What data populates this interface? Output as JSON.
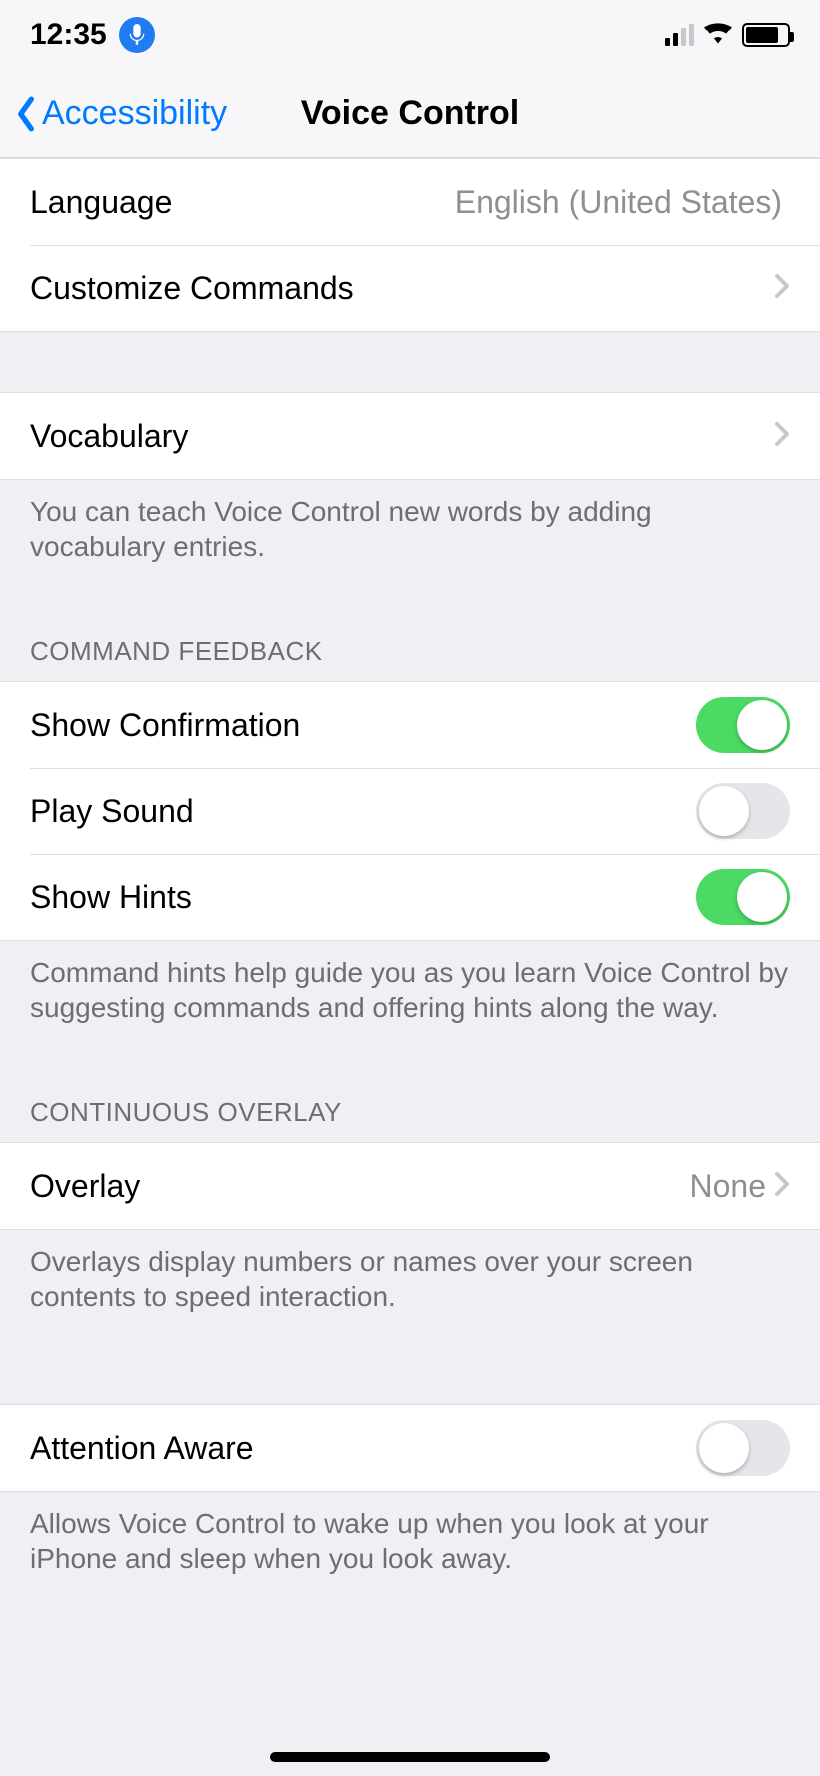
{
  "status": {
    "time": "12:35"
  },
  "nav": {
    "back": "Accessibility",
    "title": "Voice Control"
  },
  "rows": {
    "language": {
      "label": "Language",
      "value": "English (United States)"
    },
    "customize": {
      "label": "Customize Commands"
    },
    "vocabulary": {
      "label": "Vocabulary"
    },
    "vocabulary_footer": "You can teach Voice Control new words by adding vocabulary entries.",
    "feedback_header": "COMMAND FEEDBACK",
    "show_conf": {
      "label": "Show Confirmation",
      "on": true
    },
    "play_sound": {
      "label": "Play Sound",
      "on": false
    },
    "show_hints": {
      "label": "Show Hints",
      "on": true
    },
    "feedback_footer": "Command hints help guide you as you learn Voice Control by suggesting commands and offering hints along the way.",
    "overlay_header": "CONTINUOUS OVERLAY",
    "overlay": {
      "label": "Overlay",
      "value": "None"
    },
    "overlay_footer": "Overlays display numbers or names over your screen contents to speed interaction.",
    "attention": {
      "label": "Attention Aware",
      "on": false
    },
    "attention_footer": "Allows Voice Control to wake up when you look at your iPhone and sleep when you look away."
  }
}
